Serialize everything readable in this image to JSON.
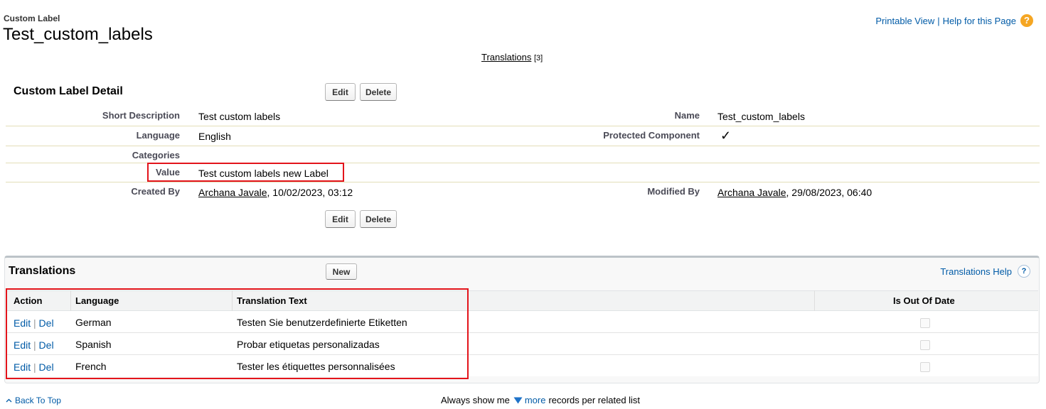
{
  "header": {
    "object_type": "Custom Label",
    "title": "Test_custom_labels",
    "printable_view": "Printable View",
    "separator": "|",
    "help_link": "Help for this Page",
    "help_icon_glyph": "?"
  },
  "related_links": {
    "translations_label": "Translations",
    "translations_count": "[3]"
  },
  "detail": {
    "section_title": "Custom Label Detail",
    "edit_label": "Edit",
    "delete_label": "Delete",
    "fields": {
      "short_description": {
        "label": "Short Description",
        "value": "Test custom labels"
      },
      "name": {
        "label": "Name",
        "value": "Test_custom_labels"
      },
      "language": {
        "label": "Language",
        "value": "English"
      },
      "protected_component": {
        "label": "Protected Component",
        "value": "✓"
      },
      "categories": {
        "label": "Categories",
        "value": ""
      },
      "value": {
        "label": "Value",
        "value": "Test custom labels new Label"
      },
      "created_by": {
        "label": "Created By",
        "user": "Archana Javale",
        "date": ", 10/02/2023, 03:12"
      },
      "modified_by": {
        "label": "Modified By",
        "user": "Archana Javale",
        "date": ", 29/08/2023, 06:40"
      }
    }
  },
  "translations": {
    "section_title": "Translations",
    "new_label": "New",
    "help_link": "Translations Help",
    "help_icon_glyph": "?",
    "columns": [
      "Action",
      "Language",
      "Translation Text",
      "Is Out Of Date"
    ],
    "rows": [
      {
        "edit": "Edit",
        "sep": "|",
        "del": "Del",
        "language": "German",
        "text": "Testen Sie benutzerdefinierte Etiketten",
        "out_of_date": false
      },
      {
        "edit": "Edit",
        "sep": "|",
        "del": "Del",
        "language": "Spanish",
        "text": "Probar etiquetas personalizadas",
        "out_of_date": false
      },
      {
        "edit": "Edit",
        "sep": "|",
        "del": "Del",
        "language": "French",
        "text": "Tester les étiquettes personnalisées",
        "out_of_date": false
      }
    ]
  },
  "footer": {
    "back_to_top": "Back To Top",
    "always_show": "Always show me",
    "more": "more",
    "records_text": "records per related list"
  },
  "colors": {
    "link": "#015ba7",
    "highlight_box": "#e3141b",
    "help_icon": "#f5a623"
  }
}
